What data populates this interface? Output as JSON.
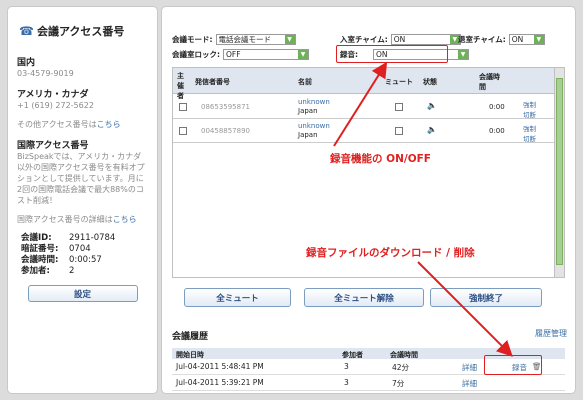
{
  "left": {
    "title": "会議アクセス番号",
    "domestic_label": "国内",
    "domestic_number": "03-4579-9019",
    "us_label": "アメリカ・カナダ",
    "us_number": "+1 (619) 272-5622",
    "other_text": "その他アクセス番号は",
    "other_link": "こちら",
    "intl_title": "国際アクセス番号",
    "intl_desc": "BizSpeakでは、アメリカ・カナダ以外の国際アクセス番号を有料オプションとして提供しています。月に2回の国際電話会議で最大88%のコスト削減！",
    "intl_more": "国際アクセス番号の詳細は",
    "intl_link": "こちら",
    "info": [
      {
        "k": "会議ID:",
        "v": "2911-0784"
      },
      {
        "k": "暗証番号:",
        "v": "0704"
      },
      {
        "k": "会議時間:",
        "v": "0:00:57"
      },
      {
        "k": "参加者:",
        "v": "2"
      }
    ],
    "settings_button": "設定"
  },
  "controls": {
    "mode_label": "会議モード:",
    "mode_value": "電話会議モード",
    "entry_label": "入室チャイム:",
    "entry_value": "ON",
    "exit_label": "退室チャイム:",
    "exit_value": "ON",
    "lock_label": "会議室ロック:",
    "lock_value": "OFF",
    "rec_label": "録音:",
    "rec_value": "ON"
  },
  "participants": {
    "headers": {
      "host": "主催者",
      "caller": "発信者番号",
      "name": "名前",
      "mute": "ミュート",
      "status": "状態",
      "time": "会議時間"
    },
    "rows": [
      {
        "caller": "08653595871",
        "name": "unknown",
        "region": "Japan",
        "time": "0:00",
        "kick": "強制切断"
      },
      {
        "caller": "00458857890",
        "name": "unknown",
        "region": "Japan",
        "time": "0:00",
        "kick": "強制切断"
      }
    ]
  },
  "buttons": {
    "mute_all": "全ミュート",
    "unmute_all": "全ミュート解除",
    "force_end": "強制終了"
  },
  "history": {
    "title": "会議履歴",
    "manage_link": "履歴管理",
    "headers": {
      "start": "開始日時",
      "participants": "参加者",
      "duration": "会議時間"
    },
    "rows": [
      {
        "start": "Jul-04-2011 5:48:41 PM",
        "participants": "3",
        "duration": "42分",
        "detail": "詳細",
        "recording": "録音"
      },
      {
        "start": "Jul-04-2011 5:39:21 PM",
        "participants": "3",
        "duration": "7分",
        "detail": "詳細",
        "recording": ""
      }
    ]
  },
  "annotations": {
    "recording_toggle": "録音機能の ON/OFF",
    "recording_download": "録音ファイルのダウンロード / 削除"
  },
  "colors": {
    "annotation": "#e02020",
    "link": "#3a6ea5",
    "header_bg": "#dfe6f0",
    "scroll_thumb": "#a7cf91"
  },
  "icons": {
    "phone": "phone-icon",
    "speaker": "speaker-icon",
    "trash": "trash-icon"
  }
}
